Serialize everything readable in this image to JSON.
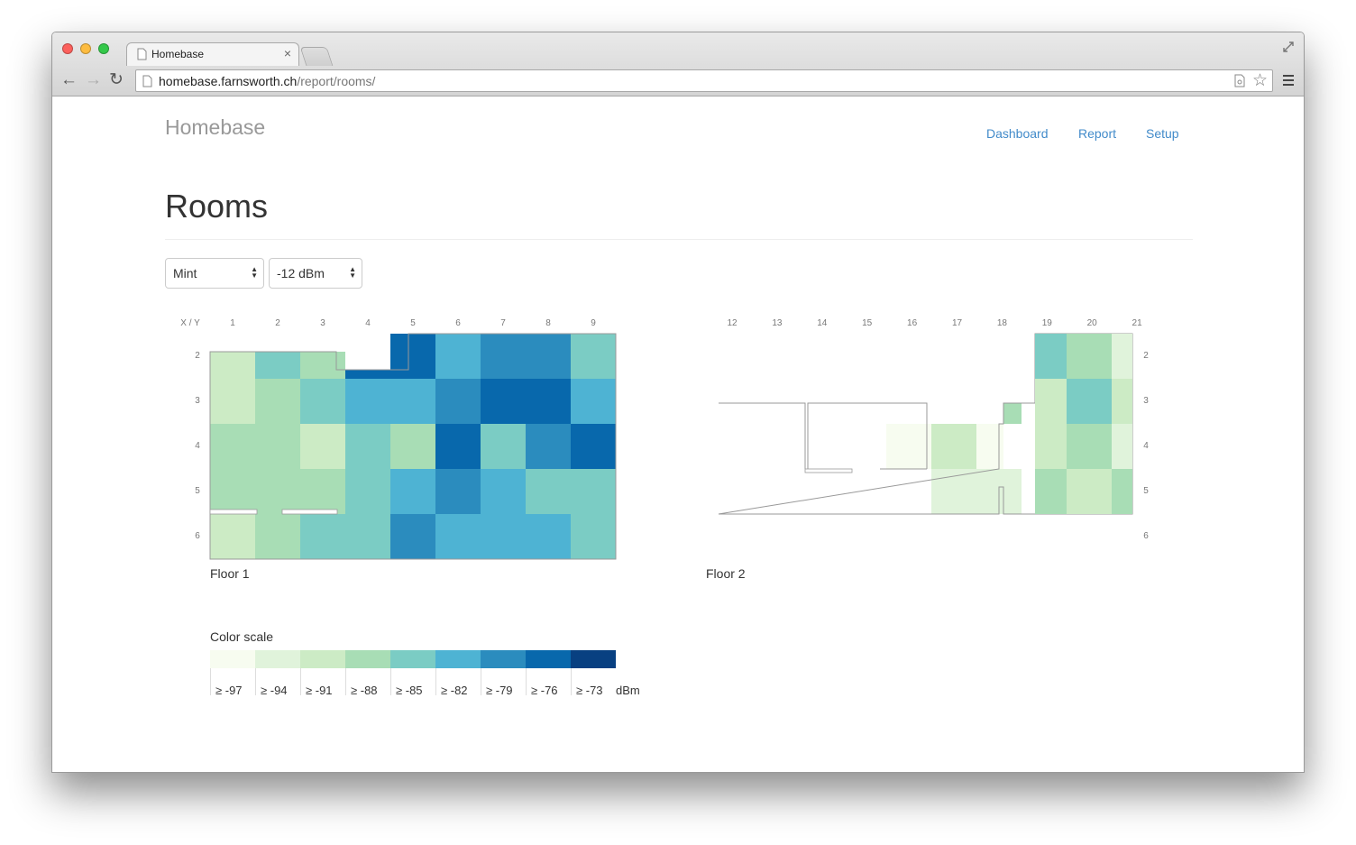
{
  "browser": {
    "tab_title": "Homebase",
    "url_host": "homebase.farnsworth.ch",
    "url_path": "/report/rooms/"
  },
  "navbar": {
    "brand": "Homebase",
    "links": [
      "Dashboard",
      "Report",
      "Setup"
    ]
  },
  "page": {
    "title": "Rooms",
    "device_select": "Mint",
    "threshold_select": "-12 dBm"
  },
  "floor1": {
    "corner_label": "X / Y",
    "x_labels": [
      "1",
      "2",
      "3",
      "4",
      "5",
      "6",
      "7",
      "8",
      "9"
    ],
    "y_labels": [
      "2",
      "3",
      "4",
      "5",
      "6"
    ],
    "caption": "Floor 1"
  },
  "floor2": {
    "x_labels": [
      "12",
      "13",
      "14",
      "15",
      "16",
      "17",
      "18",
      "19",
      "20",
      "21"
    ],
    "y_labels": [
      "2",
      "3",
      "4",
      "5",
      "6"
    ],
    "caption": "Floor 2"
  },
  "legend": {
    "title": "Color scale",
    "unit": "dBm",
    "labels": [
      "≥ -97",
      "≥ -94",
      "≥ -91",
      "≥ -88",
      "≥ -85",
      "≥ -82",
      "≥ -79",
      "≥ -76",
      "≥ -73"
    ],
    "colors": [
      "#f7fcf0",
      "#e0f3db",
      "#ccebc5",
      "#a8ddb5",
      "#7bccc4",
      "#4eb3d3",
      "#2b8cbe",
      "#0868ac",
      "#084081"
    ]
  },
  "colors": {
    "link": "#428bca",
    "brand": "#999999",
    "heading": "#333333",
    "plan_border": "#999999"
  },
  "chart_data": {
    "type": "heatmap",
    "floor1_levels": [
      [
        2,
        4,
        3,
        null,
        7,
        5,
        6,
        6,
        4
      ],
      [
        2,
        3,
        4,
        5,
        5,
        6,
        7,
        7,
        5
      ],
      [
        3,
        3,
        2,
        4,
        3,
        7,
        4,
        6,
        7
      ],
      [
        3,
        3,
        3,
        4,
        5,
        6,
        5,
        4,
        4
      ],
      [
        2,
        3,
        4,
        4,
        6,
        5,
        5,
        5,
        4
      ]
    ],
    "floor2_levels": [
      [
        4,
        3,
        1
      ],
      [
        2,
        4,
        2
      ],
      [
        2,
        3,
        1
      ],
      [
        3,
        2,
        3
      ]
    ]
  }
}
